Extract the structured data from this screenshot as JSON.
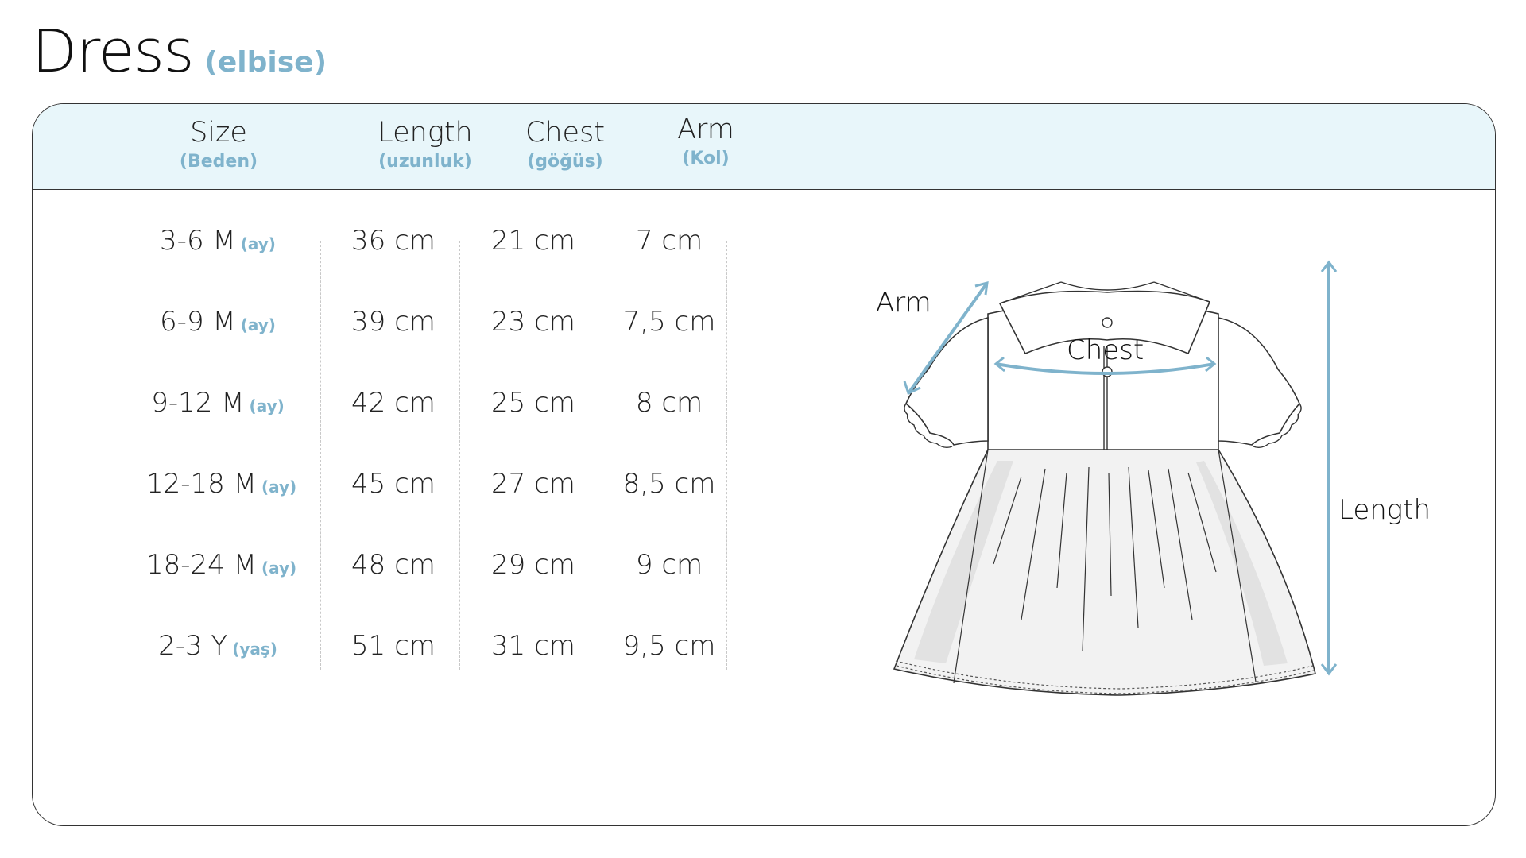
{
  "title": {
    "main": "Dress",
    "sub": "(elbise)"
  },
  "headers": [
    {
      "main": "Size",
      "tr": "(Beden)"
    },
    {
      "main": "Length",
      "tr": "(uzunluk)"
    },
    {
      "main": "Chest",
      "tr": "(göğüs)"
    },
    {
      "main": "Arm",
      "tr": "(Kol)"
    }
  ],
  "rows": [
    {
      "size": "3-6 M",
      "size_tr": "(ay)",
      "length": "36 cm",
      "chest": "21 cm",
      "arm": "7 cm"
    },
    {
      "size": "6-9 M",
      "size_tr": "(ay)",
      "length": "39 cm",
      "chest": "23 cm",
      "arm": "7,5 cm"
    },
    {
      "size": "9-12 M",
      "size_tr": "(ay)",
      "length": "42 cm",
      "chest": "25 cm",
      "arm": "8 cm"
    },
    {
      "size": "12-18 M",
      "size_tr": "(ay)",
      "length": "45 cm",
      "chest": "27 cm",
      "arm": "8,5 cm"
    },
    {
      "size": "18-24 M",
      "size_tr": "(ay)",
      "length": "48 cm",
      "chest": "29 cm",
      "arm": "9 cm"
    },
    {
      "size": "2-3 Y",
      "size_tr": "(yaş)",
      "length": "51 cm",
      "chest": "31 cm",
      "arm": "9,5 cm"
    }
  ],
  "diagram": {
    "arm_label": "Arm",
    "chest_label": "Chest",
    "length_label": "Length"
  },
  "colors": {
    "accent": "#7fb3cc",
    "header_bg": "#e8f6fa"
  }
}
